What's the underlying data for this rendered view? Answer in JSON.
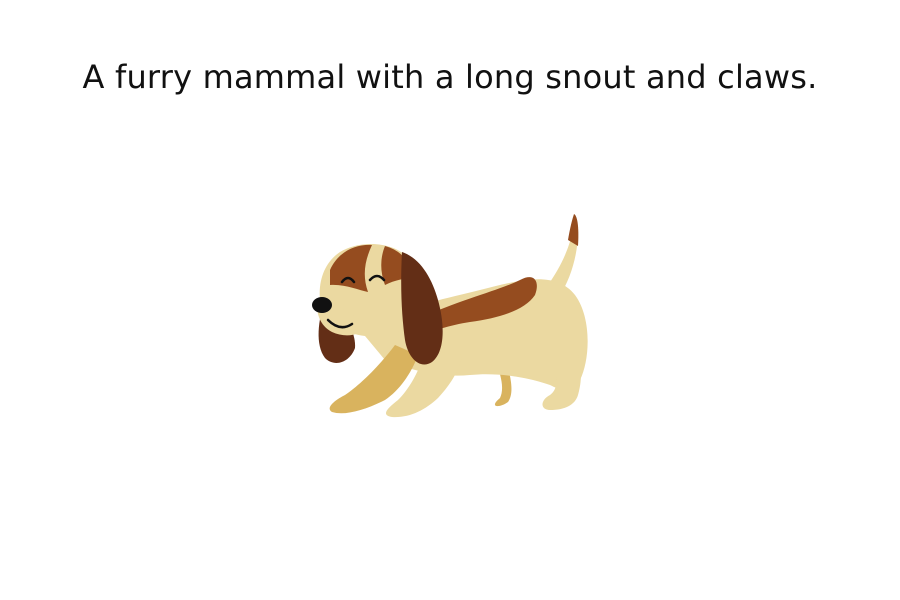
{
  "caption": "A furry mammal with a long snout and claws.",
  "illustration": {
    "icon": "dog-icon",
    "colors": {
      "cream": "#EBD9A1",
      "tan": "#D9B35E",
      "brown": "#954C1F",
      "dark_brown": "#632E16",
      "nose": "#111111"
    }
  }
}
